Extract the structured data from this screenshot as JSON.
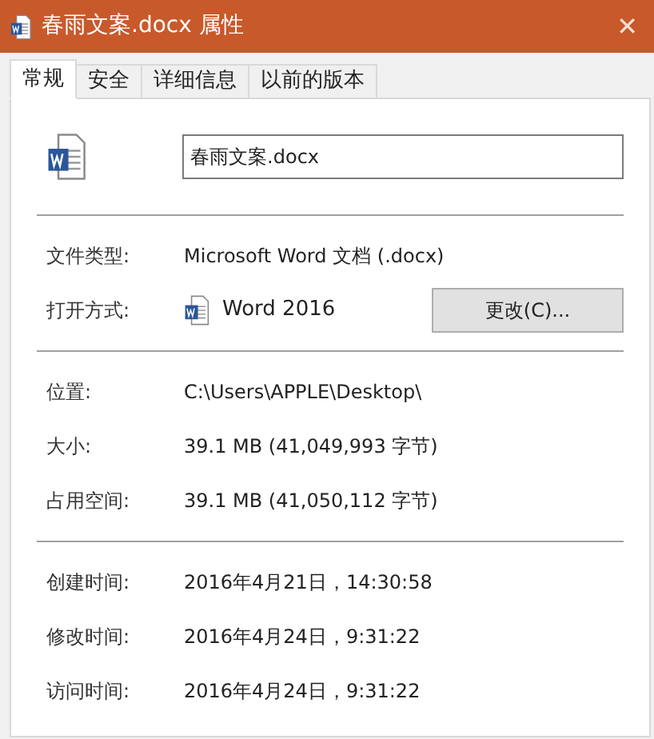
{
  "window": {
    "title": "春雨文案.docx 属性",
    "close": "✕"
  },
  "tabs": [
    {
      "label": "常规",
      "selected": true
    },
    {
      "label": "安全",
      "selected": false
    },
    {
      "label": "详细信息",
      "selected": false
    },
    {
      "label": "以前的版本",
      "selected": false
    }
  ],
  "file_name": "春雨文案.docx",
  "sections": [
    {
      "rows": [
        {
          "kind": "text",
          "label": "文件类型:",
          "value": "Microsoft Word 文档 (.docx)"
        },
        {
          "kind": "app",
          "label": "打开方式:",
          "value": "Word 2016",
          "button": "更改(C)..."
        }
      ]
    },
    {
      "rows": [
        {
          "kind": "text",
          "label": "位置:",
          "value": "C:\\Users\\APPLE\\Desktop\\"
        },
        {
          "kind": "text",
          "label": "大小:",
          "value": "39.1 MB (41,049,993 字节)"
        },
        {
          "kind": "text",
          "label": "占用空间:",
          "value": "39.1 MB (41,050,112 字节)"
        }
      ]
    },
    {
      "rows": [
        {
          "kind": "text",
          "label": "创建时间:",
          "value": "2016年4月21日，14:30:58"
        },
        {
          "kind": "text",
          "label": "修改时间:",
          "value": "2016年4月24日，9:31:22"
        },
        {
          "kind": "text",
          "label": "访问时间:",
          "value": "2016年4月24日，9:31:22"
        }
      ]
    }
  ]
}
